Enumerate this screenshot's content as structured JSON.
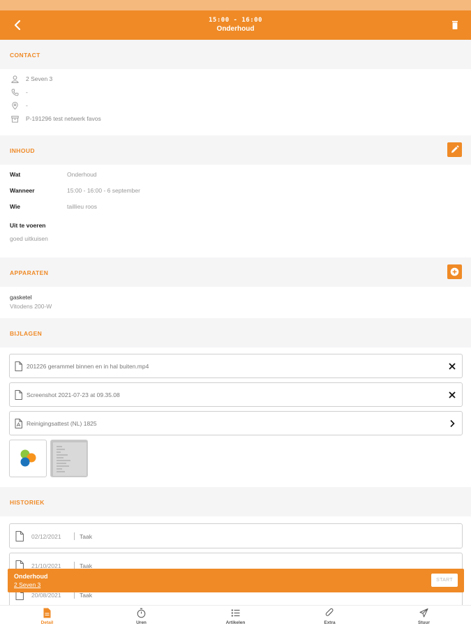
{
  "header": {
    "time": "15:00 - 16:00",
    "title": "Onderhoud"
  },
  "contact": {
    "section_label": "CONTACT",
    "name": "2 Seven 3",
    "phone": "-",
    "address": "-",
    "reference": "P-191296 test netwerk favos"
  },
  "inhoud": {
    "section_label": "INHOUD",
    "rows": [
      {
        "key": "Wat",
        "value": "Onderhoud"
      },
      {
        "key": "Wanneer",
        "value": "15:00 - 16:00 - 6 september"
      },
      {
        "key": "Wie",
        "value": "taillieu roos"
      }
    ],
    "todo_label": "Uit te voeren",
    "todo_value": "goed uitkuisen"
  },
  "apparaten": {
    "section_label": "APPARATEN",
    "device_name": "gasketel",
    "device_model": "Vitodens 200-W"
  },
  "bijlagen": {
    "section_label": "BIJLAGEN",
    "files": [
      {
        "name": "201226 gerammel binnen en in hal buiten.mp4",
        "action": "close-icon"
      },
      {
        "name": "Screenshot 2021-07-23 at 09.35.08",
        "action": "close-icon"
      },
      {
        "name": "Reinigingsattest (NL) 1825",
        "action": "chevron-right-icon"
      }
    ]
  },
  "historiek": {
    "section_label": "HISTORIEK",
    "items": [
      {
        "date": "02/12/2021",
        "type": "Taak"
      },
      {
        "date": "21/10/2021",
        "type": "Taak"
      },
      {
        "date": "20/08/2021",
        "type": "Taak"
      }
    ]
  },
  "banner": {
    "title": "Onderhoud",
    "subtitle": "2 Seven 3",
    "start_label": "START"
  },
  "tabs": [
    {
      "label": "Detail",
      "icon": "document-icon",
      "active": true
    },
    {
      "label": "Uren",
      "icon": "stopwatch-icon",
      "active": false
    },
    {
      "label": "Artikelen",
      "icon": "list-icon",
      "active": false
    },
    {
      "label": "Extra",
      "icon": "paperclip-icon",
      "active": false
    },
    {
      "label": "Stuur",
      "icon": "send-icon",
      "active": false
    }
  ],
  "colors": {
    "accent": "#ef8a26",
    "statusbar": "#f5b97e",
    "section_bg": "#f5f5f6"
  }
}
